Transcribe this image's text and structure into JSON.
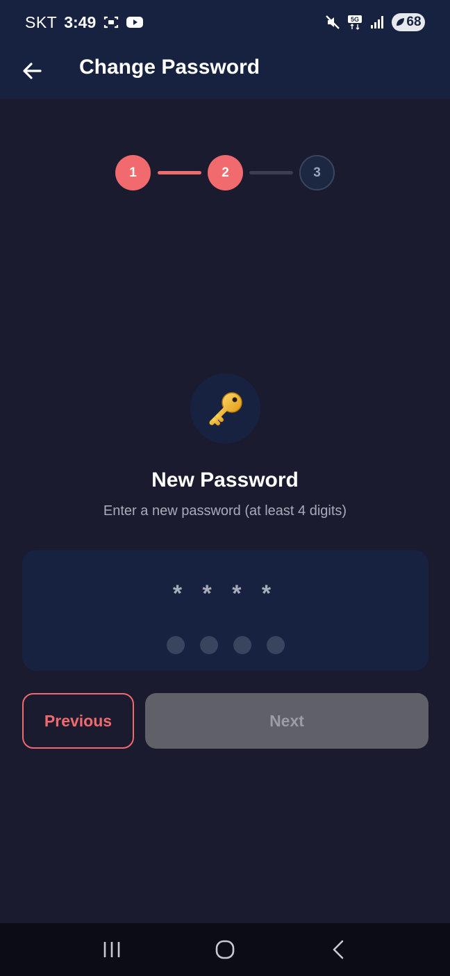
{
  "status_bar": {
    "carrier": "SKT",
    "time": "3:49",
    "battery": "68",
    "icons": [
      "screenshot-icon",
      "youtube-icon",
      "mute-icon",
      "5g-icon",
      "signal-icon",
      "battery-icon"
    ]
  },
  "header": {
    "back_icon": "arrow-left-icon",
    "title": "Change Password"
  },
  "stepper": {
    "steps": [
      {
        "label": "1",
        "state": "done"
      },
      {
        "label": "2",
        "state": "current"
      },
      {
        "label": "3",
        "state": "pending"
      }
    ]
  },
  "main": {
    "icon": "key-icon",
    "title": "New Password",
    "subtitle": "Enter a new password (at least 4 digits)",
    "masked_value": "****",
    "pin_length": 4
  },
  "buttons": {
    "previous_label": "Previous",
    "next_label": "Next"
  },
  "nav_bar": {
    "icons": [
      "recent-apps-icon",
      "home-icon",
      "back-icon"
    ]
  },
  "colors": {
    "background": "#1b1b2f",
    "header": "#162240",
    "accent": "#f06a6e",
    "card": "#172241",
    "disabled_button": "#5f6068"
  }
}
